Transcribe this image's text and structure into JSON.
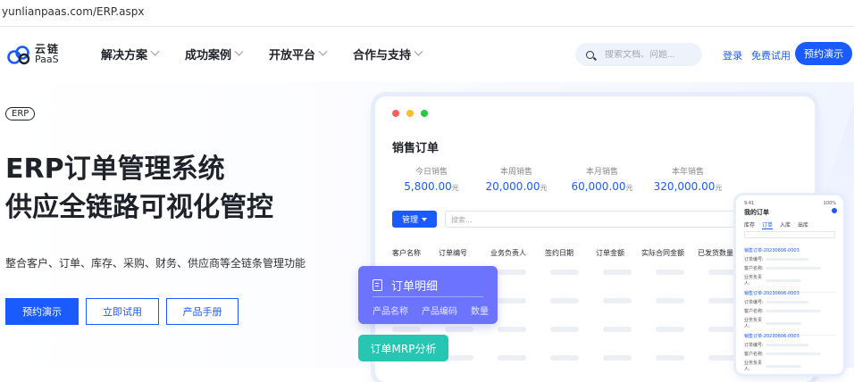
{
  "browser": {
    "url": "yunlianpaas.com/ERP.aspx"
  },
  "header": {
    "logo_cn": "云链",
    "logo_en": "PaaS",
    "menu": [
      {
        "label": "解决方案"
      },
      {
        "label": "成功案例"
      },
      {
        "label": "开放平台"
      },
      {
        "label": "合作与支持"
      }
    ],
    "search_placeholder": "搜索文档、问题...",
    "login_label": "登录",
    "trial_label": "免费试用",
    "demo_label": "预约演示"
  },
  "hero": {
    "tag": "ERP",
    "title_line1": "ERP订单管理系统",
    "title_line2": "供应全链路可视化管控",
    "subtitle": "整合客户、订单、库存、采购、财务、供应商等全链条管理功能",
    "btn_demo": "预约演示",
    "btn_trial": "立即试用",
    "btn_manual": "产品手册"
  },
  "dashboard": {
    "title": "销售订单",
    "window_dot_colors": [
      "#ff5f57",
      "#febc2e",
      "#28c840"
    ],
    "stats": [
      {
        "label": "今日销售",
        "value": "5,800.00",
        "unit": "元"
      },
      {
        "label": "本周销售",
        "value": "20,000.00",
        "unit": "元"
      },
      {
        "label": "本月销售",
        "value": "60,000.00",
        "unit": "元"
      },
      {
        "label": "本年销售",
        "value": "320,000.00",
        "unit": "元"
      }
    ],
    "manage_label": "管理",
    "search_placeholder": "搜索...",
    "columns": [
      "客户名称",
      "订单编号",
      "业务负责人",
      "签约日期",
      "订单金额",
      "实际合同金额",
      "已发货数量"
    ]
  },
  "detail_card": {
    "title": "订单明细",
    "columns": [
      "产品名称",
      "产品编码",
      "数量"
    ]
  },
  "mrp_tag": {
    "label": "订单MRP分析"
  },
  "phone": {
    "time": "9:41",
    "battery": "100%",
    "title": "我的订单",
    "tabs": [
      "库存",
      "订单",
      "入库",
      "出库"
    ],
    "orders": [
      {
        "id": "销售订单-20230606-0003"
      },
      {
        "id": "销售订单-20230606-0003"
      },
      {
        "id": "销售订单-20230606-0003"
      }
    ],
    "field_labels": [
      "订单编号:",
      "客户名称:",
      "业务负责人:"
    ]
  },
  "colors": {
    "brand": "#1a5bff",
    "purple": "#6b73ff",
    "teal": "#27c6b3"
  }
}
